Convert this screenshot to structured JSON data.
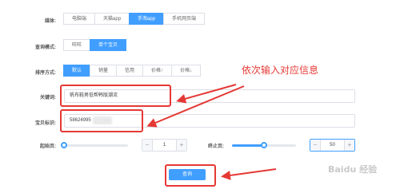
{
  "platform": {
    "label": "媒体:",
    "options": [
      "电脑端",
      "天猫app",
      "手淘app",
      "手机网页端"
    ],
    "selected_index": 2
  },
  "query_mode": {
    "label": "查询模式:",
    "options": [
      "旺旺",
      "单个宝贝"
    ],
    "selected_index": 1
  },
  "sort": {
    "label": "排序方式:",
    "options": [
      "默认",
      "销量",
      "信用",
      "价格↑",
      "价格↓"
    ],
    "selected_index": 0
  },
  "keyword": {
    "label": "关键词:",
    "value": "帆布鞋男低帮韩版潮流"
  },
  "item_id": {
    "label": "宝贝标识:",
    "value": "58624995"
  },
  "start_page": {
    "label": "起始页:",
    "value": "1",
    "slider_fraction": 0.0
  },
  "end_page": {
    "label": "终止页:",
    "value": "50",
    "slider_fraction": 0.5
  },
  "submit": {
    "label": "查询"
  },
  "annotation": {
    "text": "依次输入对应信息"
  },
  "colors": {
    "accent": "#409eff",
    "annotation_red": "#e53935"
  },
  "watermark": {
    "text": "Baidu 经验"
  }
}
